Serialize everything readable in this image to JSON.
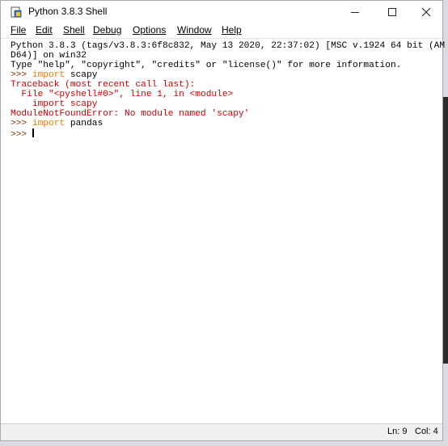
{
  "window": {
    "title": "Python 3.8.3 Shell",
    "icon": "python-idle-icon",
    "controls": [
      "minimize-icon",
      "maximize-icon",
      "close-icon"
    ]
  },
  "menu": [
    {
      "label": "File",
      "mnemonic": "F"
    },
    {
      "label": "Edit",
      "mnemonic": "E"
    },
    {
      "label": "Shell",
      "mnemonic": "S"
    },
    {
      "label": "Debug",
      "mnemonic": "D"
    },
    {
      "label": "Options",
      "mnemonic": "O"
    },
    {
      "label": "Window",
      "mnemonic": "W"
    },
    {
      "label": "Help",
      "mnemonic": "H"
    }
  ],
  "shell": {
    "banner_1": "Python 3.8.3 (tags/v3.8.3:6f8c832, May 13 2020, 22:37:02) [MSC v.1924 64 bit (AM",
    "banner_2": "D64)] on win32",
    "banner_3": "Type \"help\", \"copyright\", \"credits\" or \"license()\" for more information.",
    "prompt": ">>> ",
    "cmd1_kw": "import",
    "cmd1_rest": " scapy",
    "tb_1": "Traceback (most recent call last):",
    "tb_2": "  File \"<pyshell#0>\", line 1, in <module>",
    "tb_3_kw": "    import",
    "tb_3_rest": " scapy",
    "tb_4": "ModuleNotFoundError: No module named 'scapy'",
    "cmd2_kw": "import",
    "cmd2_rest": " pandas"
  },
  "status": {
    "line": "Ln: 9",
    "col": "Col: 4"
  },
  "colors": {
    "error": "#d00000",
    "keyword": "#ff7700",
    "prompt": "#8b2d00"
  }
}
